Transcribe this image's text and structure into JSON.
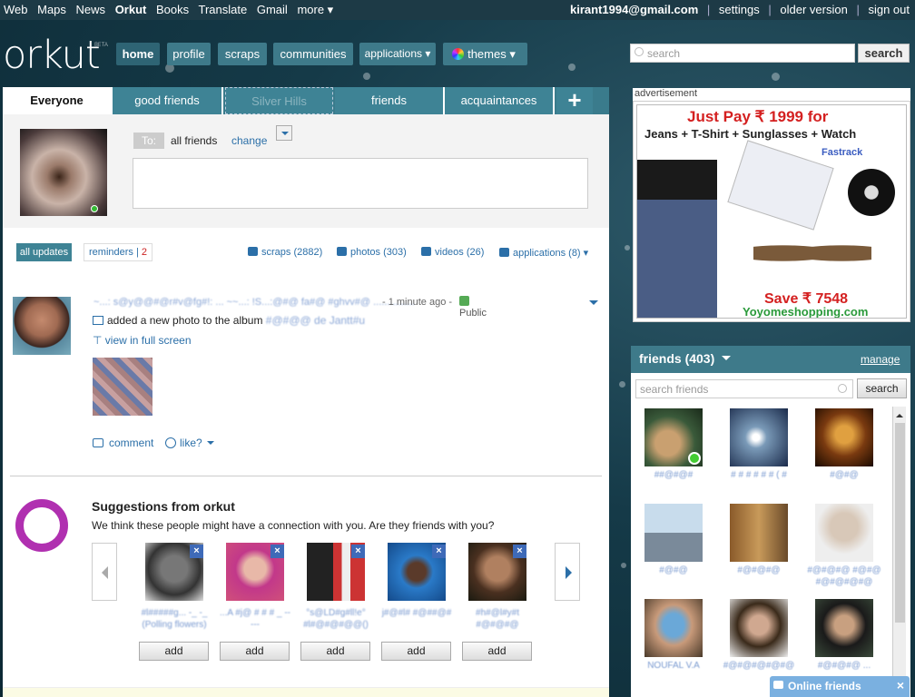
{
  "gbar": {
    "left": [
      "Web",
      "Maps",
      "News",
      "Orkut",
      "Books",
      "Translate",
      "Gmail",
      "more ▾"
    ],
    "active": "Orkut",
    "email": "kirant1994@gmail.com",
    "right": [
      "settings",
      "older version",
      "sign out"
    ]
  },
  "logo": {
    "text": "orkut",
    "beta": "BETA"
  },
  "nav": [
    "home",
    "profile",
    "scraps",
    "communities",
    "applications",
    "themes"
  ],
  "search": {
    "placeholder": "search",
    "button": "search"
  },
  "tabs": [
    "Everyone",
    "good friends",
    "Silver Hills",
    "friends",
    "acquaintances"
  ],
  "tab_add": "+",
  "compose": {
    "to_label": "To:",
    "to_value": "all friends",
    "change": "change"
  },
  "filter": {
    "all_updates": "all updates",
    "reminders_label": "reminders | ",
    "reminders_count": "2",
    "links": [
      "scraps (2882)",
      "photos (303)",
      "videos (26)",
      "applications (8)"
    ]
  },
  "post": {
    "names": "~...: s@y@@#@r#v@fg#!: ...  ~~...: !S...:@#@ fa#@ #ghvv#@  ...............",
    "time": "- 1 minute ago -",
    "visibility": "Public",
    "action": "added a new photo to the album ",
    "album": "#@#@@ de Jantt#u",
    "view_full": "view in full screen",
    "comment": "comment",
    "like": "like?"
  },
  "suggestions": {
    "title": "Suggestions from orkut",
    "desc": "We think these people might have a connection with you. Are they friends with you?",
    "people": [
      {
        "name": "#l#####g... -_ -_ (Polling flowers)",
        "add": "add"
      },
      {
        "name": "...A #j@ # # #  _ -----",
        "add": "add"
      },
      {
        "name": "°s@LD#g#ll!e° #l#@#@#@@()",
        "add": "add"
      },
      {
        "name": "j#@#l# #@##@#",
        "add": "add"
      },
      {
        "name": "#h#@l#y#t #@#@#@",
        "add": "add"
      }
    ]
  },
  "ad": {
    "label": "advertisement",
    "line1": "Just Pay ₹ 1999 for",
    "line2": "Jeans + T-Shirt + Sunglasses + Watch",
    "line3": "Fastrack",
    "line4": "Save ₹ 7548",
    "line5": "Yoyomeshopping.com"
  },
  "friends": {
    "title": "friends (403)",
    "manage": "manage",
    "search_placeholder": "search friends",
    "search_button": "search",
    "items": [
      {
        "name": "##@#@#"
      },
      {
        "name": "# # # # # # ( #"
      },
      {
        "name": "#@#@"
      },
      {
        "name": "#@#@"
      },
      {
        "name": "#@#@#@"
      },
      {
        "name": "#@#@#@ #@#@ #@#@#@#@"
      },
      {
        "name": "NOUFAL V.A"
      },
      {
        "name": "#@#@#@#@#@"
      },
      {
        "name": "#@#@#@ ..."
      }
    ]
  },
  "online": {
    "label": "Online friends",
    "close": "×"
  },
  "colors": {
    "bar": "#1d3a46",
    "nav": "#3e7a8a",
    "link": "#2b6fa8",
    "panel_head": "#3e7a8a",
    "online_bar": "#7ab0e0"
  }
}
